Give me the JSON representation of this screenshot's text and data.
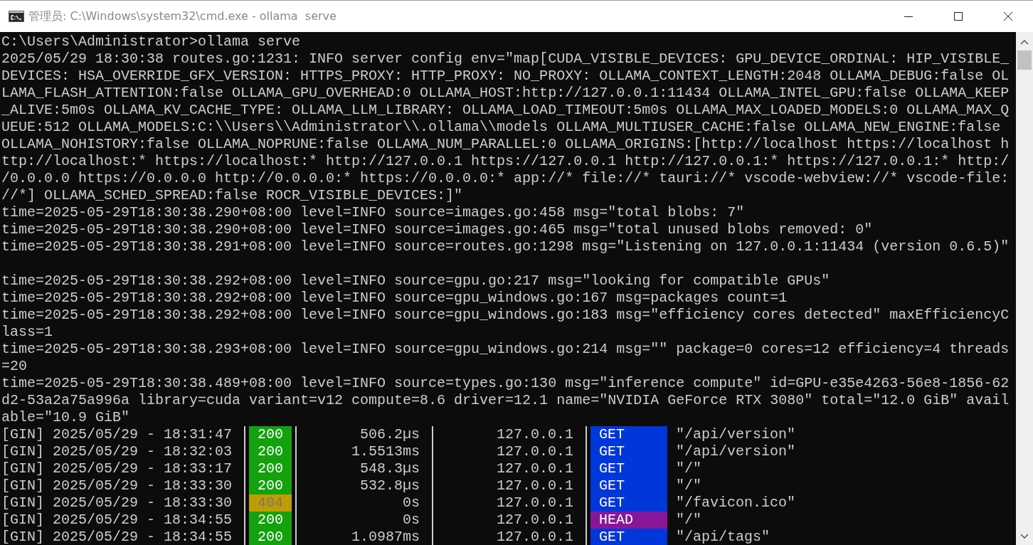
{
  "window": {
    "title": "管理员: C:\\Windows\\system32\\cmd.exe - ollama  serve"
  },
  "console": {
    "lines": [
      {
        "kind": "text",
        "text": "C:\\Users\\Administrator>ollama serve"
      },
      {
        "kind": "text",
        "text": "2025/05/29 18:30:38 routes.go:1231: INFO server config env=\"map[CUDA_VISIBLE_DEVICES: GPU_DEVICE_ORDINAL: HIP_VISIBLE_DEVICES: HSA_OVERRIDE_GFX_VERSION: HTTPS_PROXY: HTTP_PROXY: NO_PROXY: OLLAMA_CONTEXT_LENGTH:2048 OLLAMA_DEBUG:false OLLAMA_FLASH_ATTENTION:false OLLAMA_GPU_OVERHEAD:0 OLLAMA_HOST:http://127.0.0.1:11434 OLLAMA_INTEL_GPU:false OLLAMA_KEEP_ALIVE:5m0s OLLAMA_KV_CACHE_TYPE: OLLAMA_LLM_LIBRARY: OLLAMA_LOAD_TIMEOUT:5m0s OLLAMA_MAX_LOADED_MODELS:0 OLLAMA_MAX_QUEUE:512 OLLAMA_MODELS:C:\\\\Users\\\\Administrator\\\\.ollama\\\\models OLLAMA_MULTIUSER_CACHE:false OLLAMA_NEW_ENGINE:false OLLAMA_NOHISTORY:false OLLAMA_NOPRUNE:false OLLAMA_NUM_PARALLEL:0 OLLAMA_ORIGINS:[http://localhost https://localhost http://localhost:* https://localhost:* http://127.0.0.1 https://127.0.0.1 http://127.0.0.1:* https://127.0.0.1:* http://0.0.0.0 https://0.0.0.0 http://0.0.0.0:* https://0.0.0.0:* app://* file://* tauri://* vscode-webview://* vscode-file://*] OLLAMA_SCHED_SPREAD:false ROCR_VISIBLE_DEVICES:]\""
      },
      {
        "kind": "text",
        "text": "time=2025-05-29T18:30:38.290+08:00 level=INFO source=images.go:458 msg=\"total blobs: 7\""
      },
      {
        "kind": "text",
        "text": "time=2025-05-29T18:30:38.290+08:00 level=INFO source=images.go:465 msg=\"total unused blobs removed: 0\""
      },
      {
        "kind": "text",
        "text": "time=2025-05-29T18:30:38.291+08:00 level=INFO source=routes.go:1298 msg=\"Listening on 127.0.0.1:11434 (version 0.6.5)\""
      },
      {
        "kind": "blank"
      },
      {
        "kind": "text",
        "text": "time=2025-05-29T18:30:38.292+08:00 level=INFO source=gpu.go:217 msg=\"looking for compatible GPUs\""
      },
      {
        "kind": "text",
        "text": "time=2025-05-29T18:30:38.292+08:00 level=INFO source=gpu_windows.go:167 msg=packages count=1"
      },
      {
        "kind": "text",
        "text": "time=2025-05-29T18:30:38.292+08:00 level=INFO source=gpu_windows.go:183 msg=\"efficiency cores detected\" maxEfficiencyClass=1"
      },
      {
        "kind": "text",
        "text": "time=2025-05-29T18:30:38.293+08:00 level=INFO source=gpu_windows.go:214 msg=\"\" package=0 cores=12 efficiency=4 threads=20"
      },
      {
        "kind": "text",
        "text": "time=2025-05-29T18:30:38.489+08:00 level=INFO source=types.go:130 msg=\"inference compute\" id=GPU-e35e4263-56e8-1856-62d2-53a2a75a996a library=cuda variant=v12 compute=8.6 driver=12.1 name=\"NVIDIA GeForce RTX 3080\" total=\"12.0 GiB\" available=\"10.9 GiB\""
      }
    ],
    "requests": [
      {
        "prefix": "[GIN] 2025/05/29 - 18:31:47",
        "status": {
          "text": "200",
          "color": "#13a10e",
          "dimmed": false
        },
        "latency": "506.2µs",
        "ip": "127.0.0.1",
        "method": {
          "text": "GET",
          "color": "#0037da"
        },
        "path": "\"/api/version\""
      },
      {
        "prefix": "[GIN] 2025/05/29 - 18:32:03",
        "status": {
          "text": "200",
          "color": "#13a10e",
          "dimmed": false
        },
        "latency": "1.5513ms",
        "ip": "127.0.0.1",
        "method": {
          "text": "GET",
          "color": "#0037da"
        },
        "path": "\"/api/version\""
      },
      {
        "prefix": "[GIN] 2025/05/29 - 18:33:17",
        "status": {
          "text": "200",
          "color": "#13a10e",
          "dimmed": false
        },
        "latency": "548.3µs",
        "ip": "127.0.0.1",
        "method": {
          "text": "GET",
          "color": "#0037da"
        },
        "path": "\"/\""
      },
      {
        "prefix": "[GIN] 2025/05/29 - 18:33:30",
        "status": {
          "text": "200",
          "color": "#13a10e",
          "dimmed": false
        },
        "latency": "532.8µs",
        "ip": "127.0.0.1",
        "method": {
          "text": "GET",
          "color": "#0037da"
        },
        "path": "\"/\""
      },
      {
        "prefix": "[GIN] 2025/05/29 - 18:33:30",
        "status": {
          "text": "404",
          "color": "#c19c00",
          "dimmed": true
        },
        "latency": "0s",
        "ip": "127.0.0.1",
        "method": {
          "text": "GET",
          "color": "#0037da"
        },
        "path": "\"/favicon.ico\""
      },
      {
        "prefix": "[GIN] 2025/05/29 - 18:34:55",
        "status": {
          "text": "200",
          "color": "#13a10e",
          "dimmed": false
        },
        "latency": "0s",
        "ip": "127.0.0.1",
        "method": {
          "text": "HEAD",
          "color": "#881798"
        },
        "path": "\"/\""
      },
      {
        "prefix": "[GIN] 2025/05/29 - 18:34:55",
        "status": {
          "text": "200",
          "color": "#13a10e",
          "dimmed": false
        },
        "latency": "1.0987ms",
        "ip": "127.0.0.1",
        "method": {
          "text": "GET",
          "color": "#0037da"
        },
        "path": "\"/api/tags\""
      }
    ]
  }
}
